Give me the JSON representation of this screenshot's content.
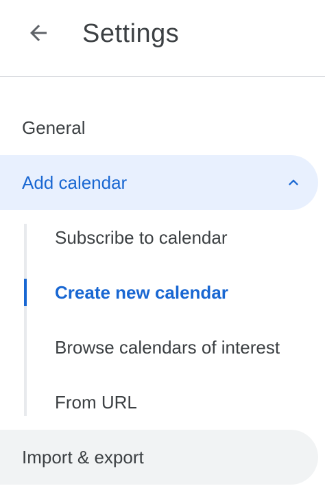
{
  "header": {
    "title": "Settings",
    "back_icon": "arrow-back-icon"
  },
  "nav": {
    "general": "General",
    "add_calendar": "Add calendar",
    "add_calendar_icon": "chevron-up-icon",
    "import_export": "Import & export"
  },
  "add_calendar_items": [
    {
      "label": "Subscribe to calendar",
      "active": false
    },
    {
      "label": "Create new calendar",
      "active": true
    },
    {
      "label": "Browse calendars of interest",
      "active": false
    },
    {
      "label": "From URL",
      "active": false
    }
  ],
  "colors": {
    "accent": "#1967d2",
    "active_bg": "#e8f0fe",
    "hover_bg": "#f1f3f4",
    "text": "#3c4043"
  }
}
